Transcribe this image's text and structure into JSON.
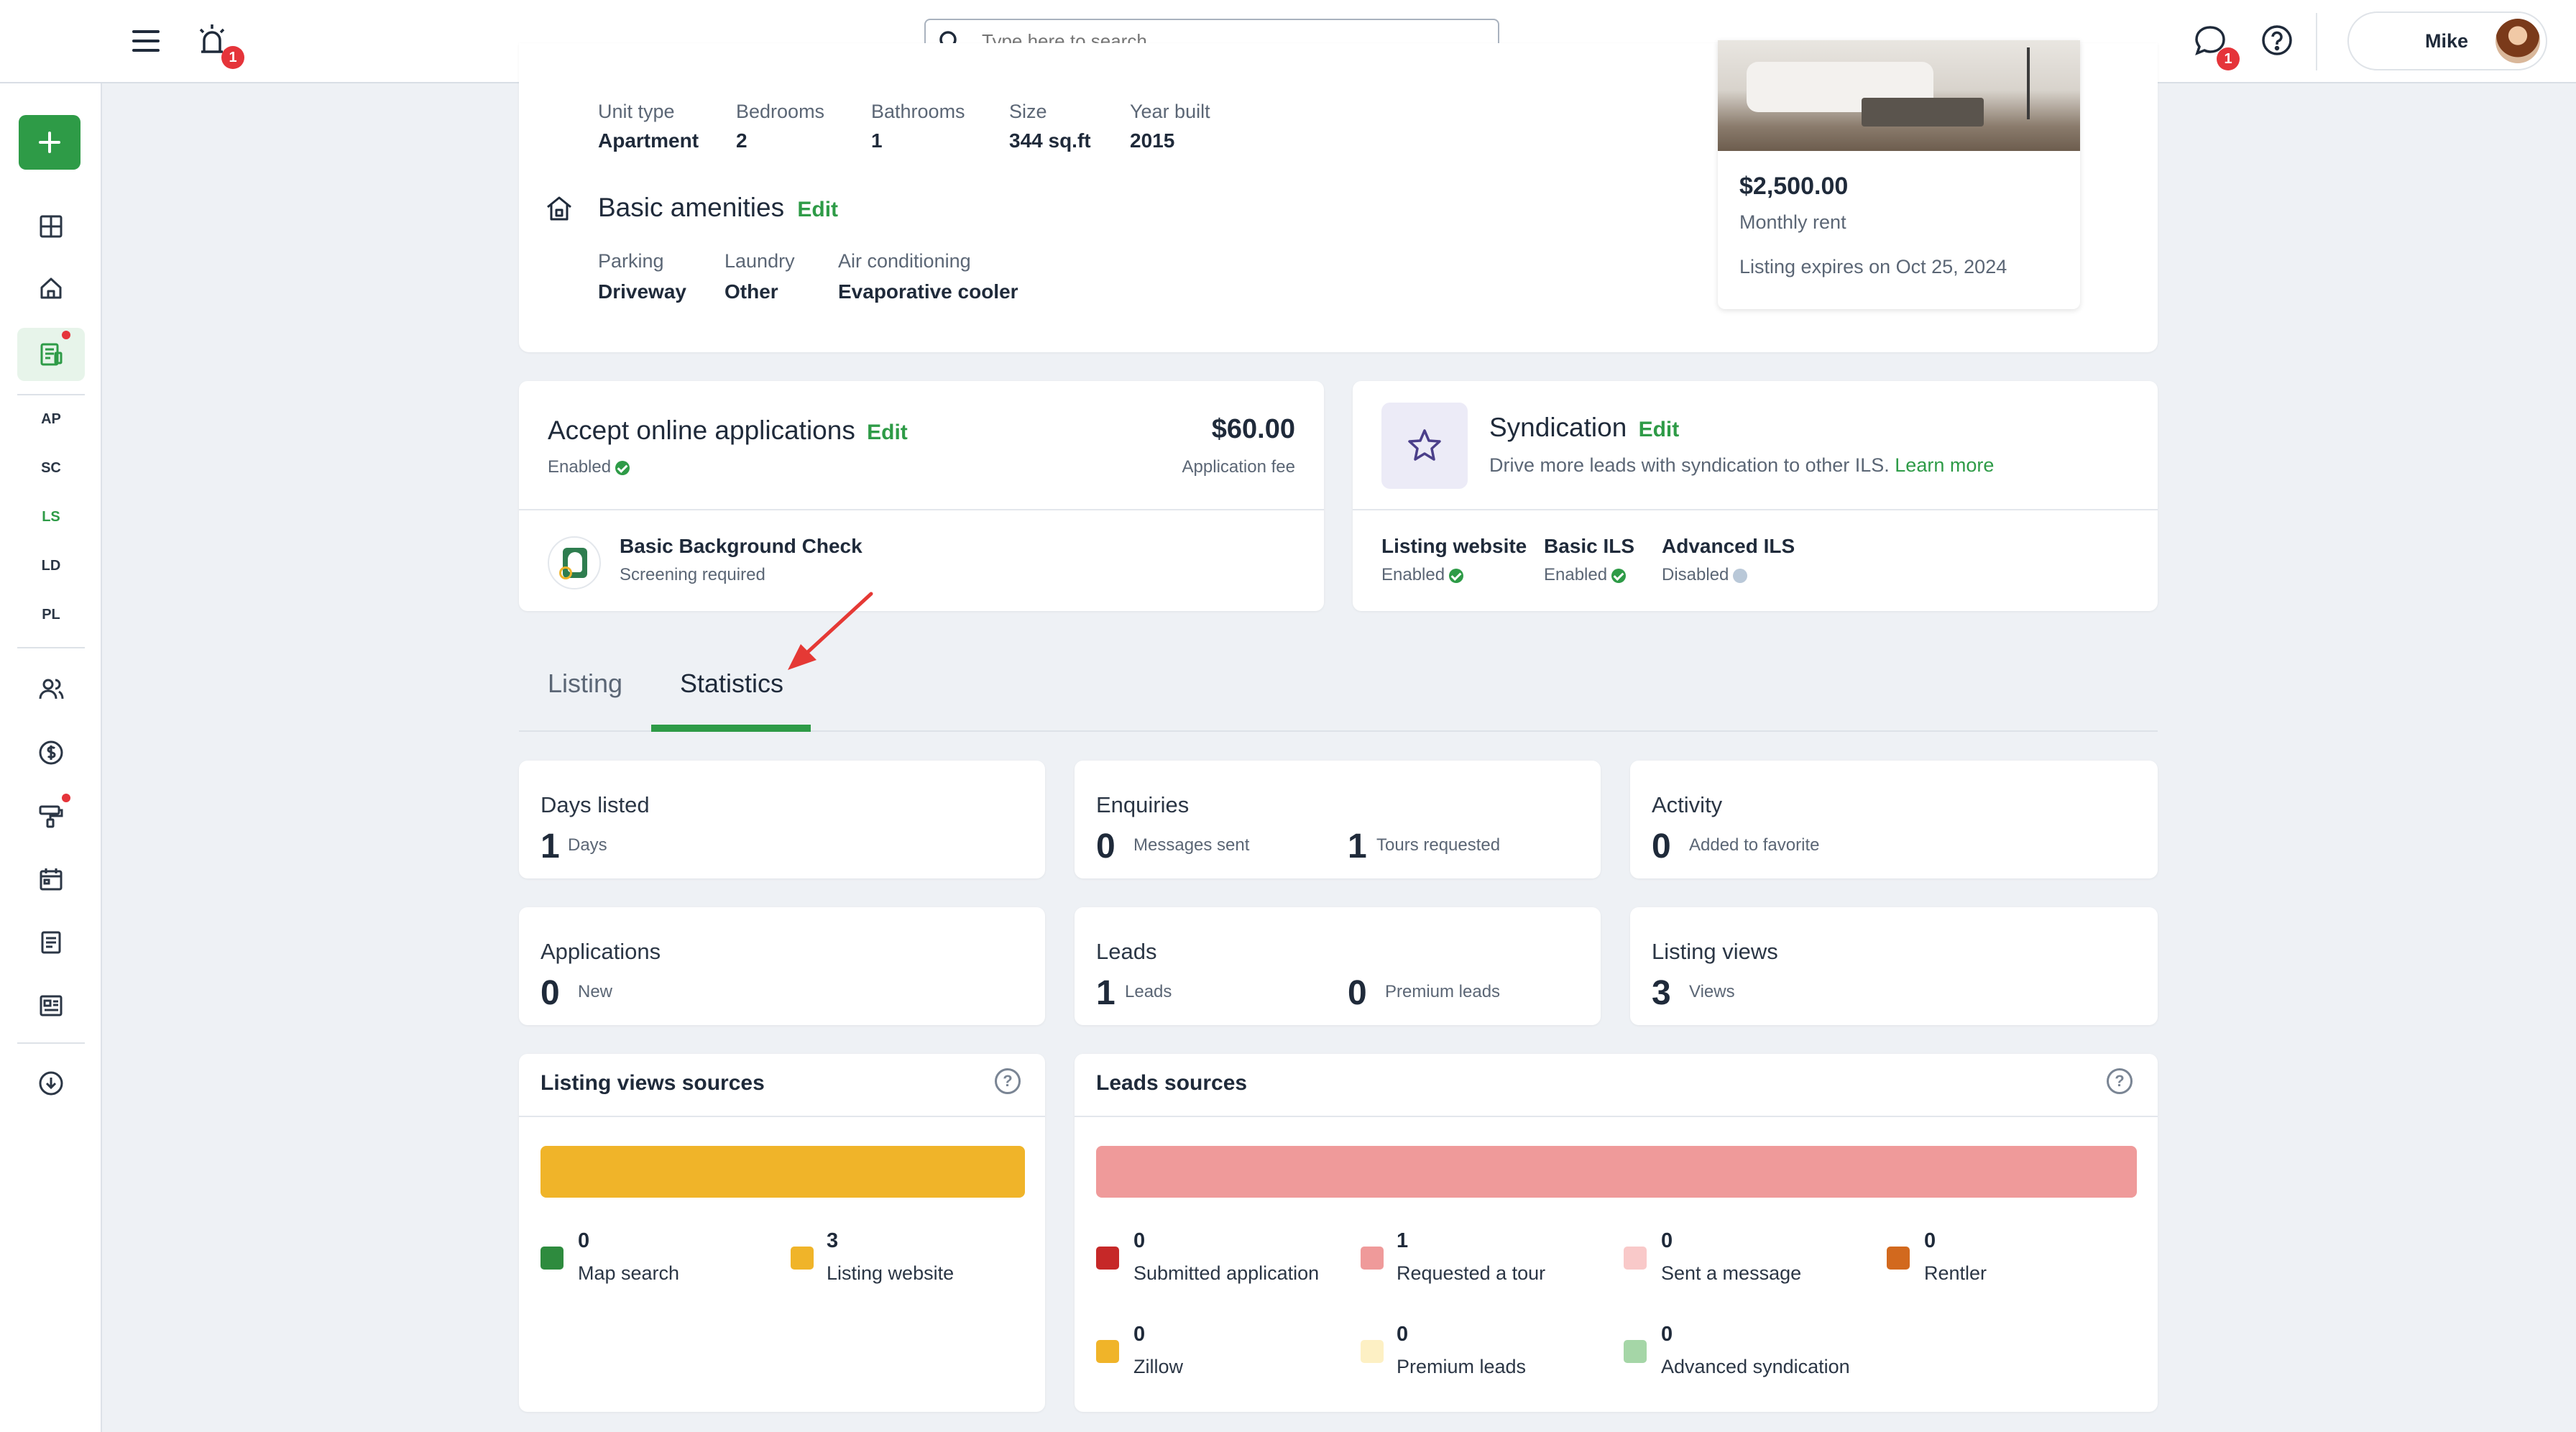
{
  "topbar": {
    "notification_count": "1",
    "search_placeholder": "Type here to search...",
    "message_count": "1",
    "user_name": "Mike"
  },
  "sidebar": {
    "labels": [
      "AP",
      "SC",
      "LS",
      "LD",
      "PL"
    ],
    "active_label": "LS"
  },
  "unit": {
    "details": [
      {
        "label": "Unit type",
        "value": "Apartment"
      },
      {
        "label": "Bedrooms",
        "value": "2"
      },
      {
        "label": "Bathrooms",
        "value": "1"
      },
      {
        "label": "Size",
        "value": "344 sq.ft"
      },
      {
        "label": "Year built",
        "value": "2015"
      }
    ],
    "amenities_title": "Basic amenities",
    "edit_label": "Edit",
    "amenities": [
      {
        "label": "Parking",
        "value": "Driveway"
      },
      {
        "label": "Laundry",
        "value": "Other"
      },
      {
        "label": "Air conditioning",
        "value": "Evaporative cooler"
      }
    ]
  },
  "price_card": {
    "price": "$2,500.00",
    "price_label": "Monthly rent",
    "expires": "Listing expires on Oct 25, 2024"
  },
  "applications": {
    "title": "Accept online applications",
    "edit_label": "Edit",
    "status": "Enabled",
    "fee": "$60.00",
    "fee_label": "Application fee",
    "screening_title": "Basic Background Check",
    "screening_sub": "Screening required"
  },
  "syndication": {
    "title": "Syndication",
    "edit_label": "Edit",
    "desc": "Drive more leads with syndication to other ILS.",
    "learn_more": "Learn more",
    "channels": [
      {
        "name": "Listing website",
        "status": "Enabled"
      },
      {
        "name": "Basic ILS",
        "status": "Enabled"
      },
      {
        "name": "Advanced ILS",
        "status": "Disabled"
      }
    ]
  },
  "tabs": [
    {
      "label": "Listing",
      "active": false
    },
    {
      "label": "Statistics",
      "active": true
    }
  ],
  "stats": {
    "days_listed": {
      "title": "Days listed",
      "num": "1",
      "sub": "Days"
    },
    "enquiries": {
      "title": "Enquiries",
      "num1": "0",
      "sub1": "Messages sent",
      "num2": "1",
      "sub2": "Tours requested"
    },
    "activity": {
      "title": "Activity",
      "num": "0",
      "sub": "Added to favorite"
    },
    "applications": {
      "title": "Applications",
      "num": "0",
      "sub": "New"
    },
    "leads": {
      "title": "Leads",
      "num1": "1",
      "sub1": "Leads",
      "num2": "0",
      "sub2": "Premium leads"
    },
    "listing_views": {
      "title": "Listing views",
      "num": "3",
      "sub": "Views"
    }
  },
  "views_sources": {
    "title": "Listing views sources",
    "bar_color": "#f0b429",
    "items": [
      {
        "value": "0",
        "label": "Map search",
        "color": "#2e8b3e"
      },
      {
        "value": "3",
        "label": "Listing website",
        "color": "#f0b429"
      }
    ]
  },
  "leads_sources": {
    "title": "Leads sources",
    "bar_color": "#ef9a9a",
    "items": [
      {
        "value": "0",
        "label": "Submitted application",
        "color": "#c62828"
      },
      {
        "value": "1",
        "label": "Requested a tour",
        "color": "#ef9a9a"
      },
      {
        "value": "0",
        "label": "Sent a message",
        "color": "#f9c9c9"
      },
      {
        "value": "0",
        "label": "Rentler",
        "color": "#d2691e"
      },
      {
        "value": "0",
        "label": "Zillow",
        "color": "#f0b429"
      },
      {
        "value": "0",
        "label": "Premium leads",
        "color": "#fdf0c4"
      },
      {
        "value": "0",
        "label": "Advanced syndication",
        "color": "#a5d6a7"
      }
    ]
  }
}
